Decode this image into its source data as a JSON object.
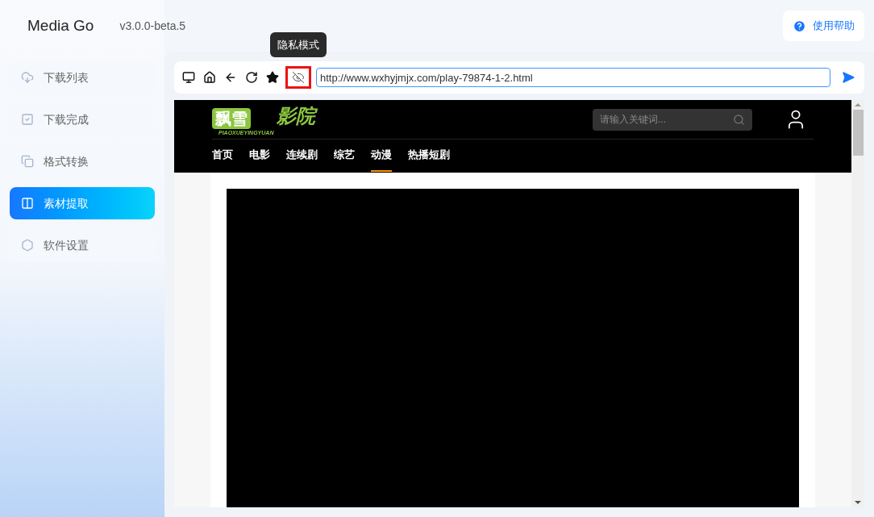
{
  "app": {
    "name": "Media Go",
    "version": "v3.0.0-beta.5",
    "help": "使用帮助"
  },
  "sidebar": {
    "items": [
      {
        "label": "下载列表",
        "kind": "download",
        "selected": false
      },
      {
        "label": "下载完成",
        "kind": "done",
        "selected": false
      },
      {
        "label": "格式转换",
        "kind": "convert",
        "selected": false
      },
      {
        "label": "素材提取",
        "kind": "extract",
        "selected": true
      },
      {
        "label": "软件设置",
        "kind": "settings",
        "selected": false
      }
    ]
  },
  "toolbar": {
    "buttons": [
      {
        "kind": "desktop",
        "highlighted": false
      },
      {
        "kind": "home",
        "highlighted": false
      },
      {
        "kind": "back",
        "highlighted": false
      },
      {
        "kind": "reload",
        "highlighted": false
      },
      {
        "kind": "star",
        "highlighted": false
      },
      {
        "kind": "privacy",
        "highlighted": true
      }
    ],
    "tooltip": "隐私模式",
    "url": "http://www.wxhyjmjx.com/play-79874-1-2.html"
  },
  "site": {
    "logo": "飘雪",
    "logo_script": "影院",
    "logo_sub": "PIAOXUEYINGYUAN",
    "search": {
      "placeholder": "请输入关键词..."
    },
    "nav": [
      {
        "label": "首页",
        "selected": false
      },
      {
        "label": "电影",
        "selected": false
      },
      {
        "label": "连续剧",
        "selected": false
      },
      {
        "label": "综艺",
        "selected": false
      },
      {
        "label": "动漫",
        "selected": true
      },
      {
        "label": "热播短剧",
        "selected": false
      }
    ]
  }
}
